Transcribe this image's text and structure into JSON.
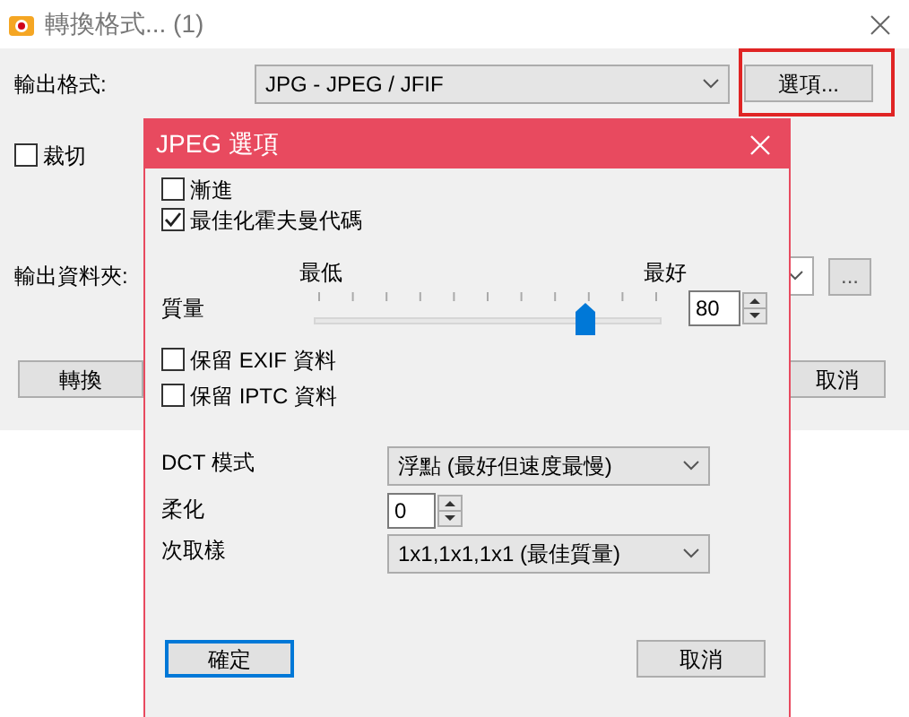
{
  "window": {
    "title": "轉換格式... (1)"
  },
  "output_format": {
    "label": "輸出格式:",
    "value": "JPG - JPEG / JFIF",
    "options_button": "選項...",
    "highlighted": true
  },
  "crop": {
    "label": "裁切",
    "checked": false
  },
  "output_folder": {
    "label": "輸出資料夾:",
    "browse_button": "..."
  },
  "buttons": [
    "轉換",
    "取消"
  ],
  "dialog": {
    "title": "JPEG 選項",
    "options": [
      {
        "label": "漸進",
        "checked": false
      },
      {
        "label": "最佳化霍夫曼代碼",
        "checked": true
      }
    ],
    "quality": {
      "label": "質量",
      "min_label": "最低",
      "max_label": "最好",
      "level": 0.8,
      "value": "80"
    },
    "metadata": [
      {
        "label": "保留 EXIF 資料",
        "checked": false
      },
      {
        "label": "保留 IPTC 資料",
        "checked": false
      }
    ],
    "dct": {
      "label": "DCT 模式",
      "value": "浮點 (最好但速度最慢)"
    },
    "smoothing": {
      "label": "柔化",
      "value": "0"
    },
    "subsampling": {
      "label": "次取樣",
      "value": "1x1,1x1,1x1 (最佳質量)"
    },
    "ok_button": "確定",
    "cancel_button": "取消"
  }
}
